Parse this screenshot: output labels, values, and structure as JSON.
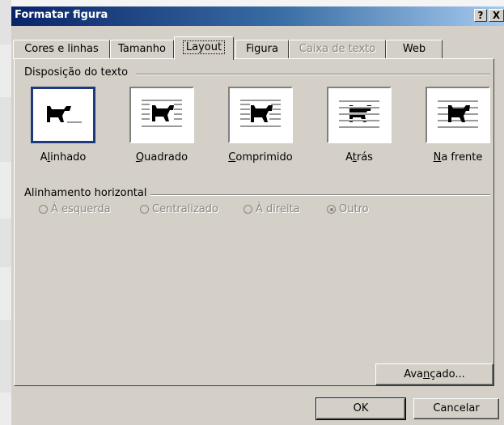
{
  "window": {
    "title": "Formatar figura",
    "help_button": "?",
    "close_button": "X"
  },
  "tabs": [
    {
      "label": "Cores e linhas",
      "state": "normal"
    },
    {
      "label": "Tamanho",
      "state": "normal"
    },
    {
      "label": "Layout",
      "state": "active"
    },
    {
      "label": "Figura",
      "state": "normal"
    },
    {
      "label": "Caixa de texto",
      "state": "disabled"
    },
    {
      "label": "Web",
      "state": "normal"
    }
  ],
  "text_wrapping": {
    "group_label": "Disposição do texto",
    "options": [
      {
        "pre": "A",
        "hot": "l",
        "post": "inhado",
        "icon": "in-line-icon",
        "selected": true
      },
      {
        "pre": "",
        "hot": "Q",
        "post": "uadrado",
        "icon": "square-icon",
        "selected": false
      },
      {
        "pre": "",
        "hot": "C",
        "post": "omprimido",
        "icon": "tight-icon",
        "selected": false
      },
      {
        "pre": "A",
        "hot": "t",
        "post": "rás",
        "icon": "behind-text-icon",
        "selected": false
      },
      {
        "pre": "",
        "hot": "N",
        "post": "a frente",
        "icon": "in-front-icon",
        "selected": false
      }
    ]
  },
  "horizontal_alignment": {
    "group_label": "Alinhamento horizontal",
    "options": [
      {
        "label": "À esquerda",
        "checked": false
      },
      {
        "label": "Centralizado",
        "checked": false
      },
      {
        "label": "À direita",
        "checked": false
      },
      {
        "label": "Outro",
        "checked": true
      }
    ],
    "enabled": false
  },
  "buttons": {
    "advanced": {
      "pre": "Ava",
      "hot": "n",
      "post": "çado..."
    },
    "ok": "OK",
    "cancel": "Cancelar"
  },
  "colors": {
    "dialog_bg": "#d4d0c8",
    "title_gradient_start": "#0a246a",
    "selected_border": "#1e3a7b",
    "disabled_text": "#8a877f"
  }
}
